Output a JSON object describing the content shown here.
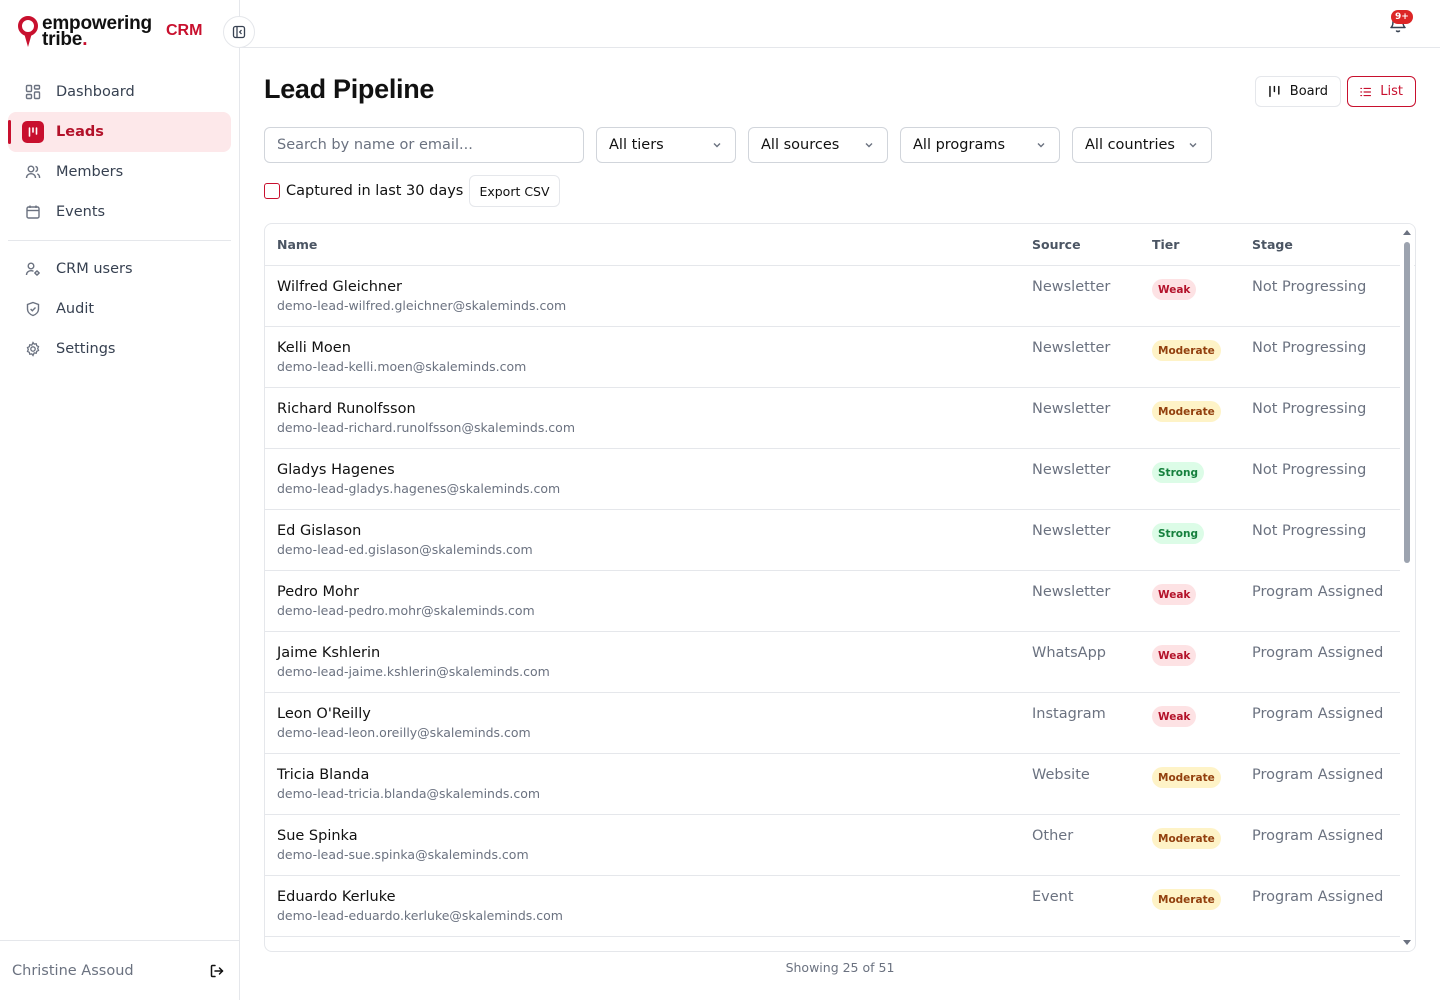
{
  "brand": {
    "line1": "empowering",
    "line2": "tribe",
    "dot": ".",
    "crm": "CRM"
  },
  "nav_primary": [
    {
      "label": "Dashboard",
      "icon": "dashboard-icon"
    },
    {
      "label": "Leads",
      "icon": "leads-icon",
      "active": true
    },
    {
      "label": "Members",
      "icon": "members-icon"
    },
    {
      "label": "Events",
      "icon": "calendar-icon"
    }
  ],
  "nav_secondary": [
    {
      "label": "CRM users",
      "icon": "crm-users-icon"
    },
    {
      "label": "Audit",
      "icon": "shield-icon"
    },
    {
      "label": "Settings",
      "icon": "gear-icon"
    }
  ],
  "footer": {
    "user": "Christine Assoud"
  },
  "notifications": {
    "badge": "9+"
  },
  "page": {
    "title": "Lead Pipeline"
  },
  "views": {
    "board": "Board",
    "list": "List",
    "active": "List"
  },
  "filters": {
    "search_placeholder": "Search by name or email...",
    "tiers": "All tiers",
    "sources": "All sources",
    "programs": "All programs",
    "countries": "All countries",
    "recent_label": "Captured in last 30 days",
    "recent_checked": false,
    "export": "Export CSV"
  },
  "table": {
    "headers": {
      "name": "Name",
      "source": "Source",
      "tier": "Tier",
      "stage": "Stage"
    },
    "rows": [
      {
        "name": "Wilfred Gleichner",
        "email": "demo-lead-wilfred.gleichner@skaleminds.com",
        "source": "Newsletter",
        "tier": "Weak",
        "stage": "Not Progressing"
      },
      {
        "name": "Kelli Moen",
        "email": "demo-lead-kelli.moen@skaleminds.com",
        "source": "Newsletter",
        "tier": "Moderate",
        "stage": "Not Progressing"
      },
      {
        "name": "Richard Runolfsson",
        "email": "demo-lead-richard.runolfsson@skaleminds.com",
        "source": "Newsletter",
        "tier": "Moderate",
        "stage": "Not Progressing"
      },
      {
        "name": "Gladys Hagenes",
        "email": "demo-lead-gladys.hagenes@skaleminds.com",
        "source": "Newsletter",
        "tier": "Strong",
        "stage": "Not Progressing"
      },
      {
        "name": "Ed Gislason",
        "email": "demo-lead-ed.gislason@skaleminds.com",
        "source": "Newsletter",
        "tier": "Strong",
        "stage": "Not Progressing"
      },
      {
        "name": "Pedro Mohr",
        "email": "demo-lead-pedro.mohr@skaleminds.com",
        "source": "Newsletter",
        "tier": "Weak",
        "stage": "Program Assigned"
      },
      {
        "name": "Jaime Kshlerin",
        "email": "demo-lead-jaime.kshlerin@skaleminds.com",
        "source": "WhatsApp",
        "tier": "Weak",
        "stage": "Program Assigned"
      },
      {
        "name": "Leon O'Reilly",
        "email": "demo-lead-leon.oreilly@skaleminds.com",
        "source": "Instagram",
        "tier": "Weak",
        "stage": "Program Assigned"
      },
      {
        "name": "Tricia Blanda",
        "email": "demo-lead-tricia.blanda@skaleminds.com",
        "source": "Website",
        "tier": "Moderate",
        "stage": "Program Assigned"
      },
      {
        "name": "Sue Spinka",
        "email": "demo-lead-sue.spinka@skaleminds.com",
        "source": "Other",
        "tier": "Moderate",
        "stage": "Program Assigned"
      },
      {
        "name": "Eduardo Kerluke",
        "email": "demo-lead-eduardo.kerluke@skaleminds.com",
        "source": "Event",
        "tier": "Moderate",
        "stage": "Program Assigned"
      }
    ]
  },
  "tier_colors": {
    "Weak": "#fde2e4",
    "Moderate": "#fef3c7",
    "Strong": "#dcfce7"
  },
  "accent": "#c8102e",
  "pagination": {
    "text": "Showing 25 of 51"
  }
}
